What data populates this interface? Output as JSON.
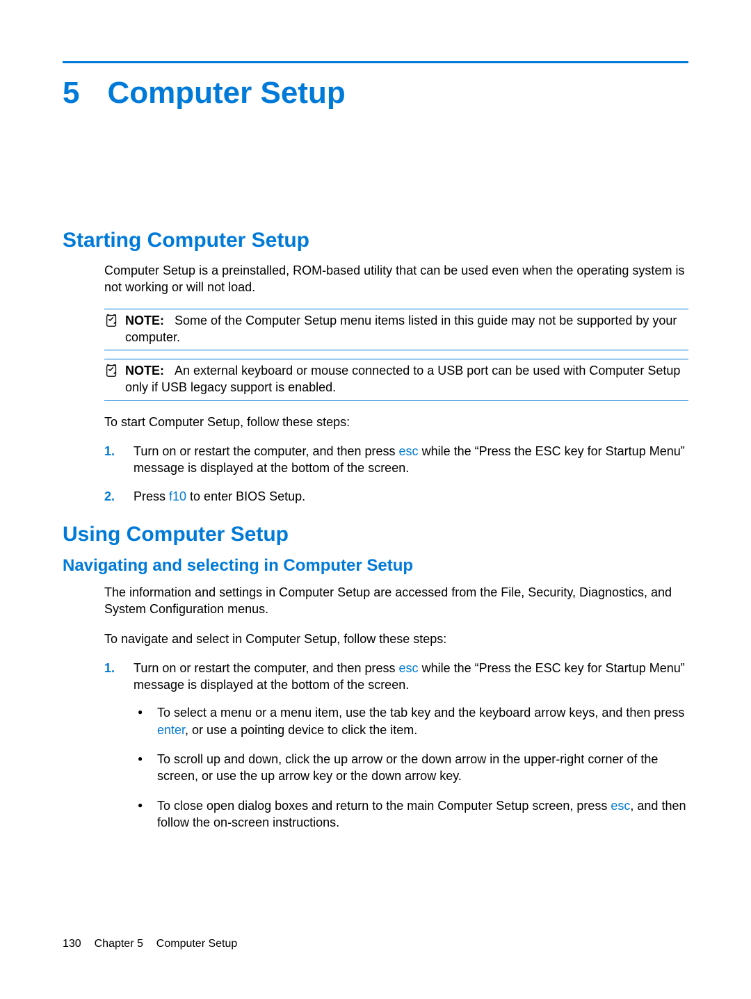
{
  "chapter": {
    "number": "5",
    "title": "Computer Setup"
  },
  "section1": {
    "heading": "Starting Computer Setup",
    "intro": "Computer Setup is a preinstalled, ROM-based utility that can be used even when the operating system is not working or will not load.",
    "note1": {
      "label": "NOTE:",
      "text": "Some of the Computer Setup menu items listed in this guide may not be supported by your computer."
    },
    "note2": {
      "label": "NOTE:",
      "text": "An external keyboard or mouse connected to a USB port can be used with Computer Setup only if USB legacy support is enabled."
    },
    "lead": "To start Computer Setup, follow these steps:",
    "step1": {
      "a": "Turn on or restart the computer, and then press ",
      "key": "esc",
      "b": " while the “Press the ESC key for Startup Menu” message is displayed at the bottom of the screen."
    },
    "step2": {
      "a": "Press ",
      "key": "f10",
      "b": " to enter BIOS Setup."
    }
  },
  "section2": {
    "heading": "Using Computer Setup",
    "sub1": {
      "heading": "Navigating and selecting in Computer Setup",
      "p1": "The information and settings in Computer Setup are accessed from the File, Security, Diagnostics, and System Configuration menus.",
      "p2": "To navigate and select in Computer Setup, follow these steps:",
      "step1": {
        "a": "Turn on or restart the computer, and then press ",
        "key": "esc",
        "b": " while the “Press the ESC key for Startup Menu” message is displayed at the bottom of the screen."
      },
      "bullet1": {
        "a": "To select a menu or a menu item, use the tab key and the keyboard arrow keys, and then press ",
        "key": "enter",
        "b": ", or use a pointing device to click the item."
      },
      "bullet2": "To scroll up and down, click the up arrow or the down arrow in the upper-right corner of the screen, or use the up arrow key or the down arrow key.",
      "bullet3": {
        "a": "To close open dialog boxes and return to the main Computer Setup screen, press ",
        "key": "esc",
        "b": ", and then follow the on-screen instructions."
      }
    }
  },
  "footer": {
    "page": "130",
    "chapter_label": "Chapter 5",
    "title": "Computer Setup"
  }
}
